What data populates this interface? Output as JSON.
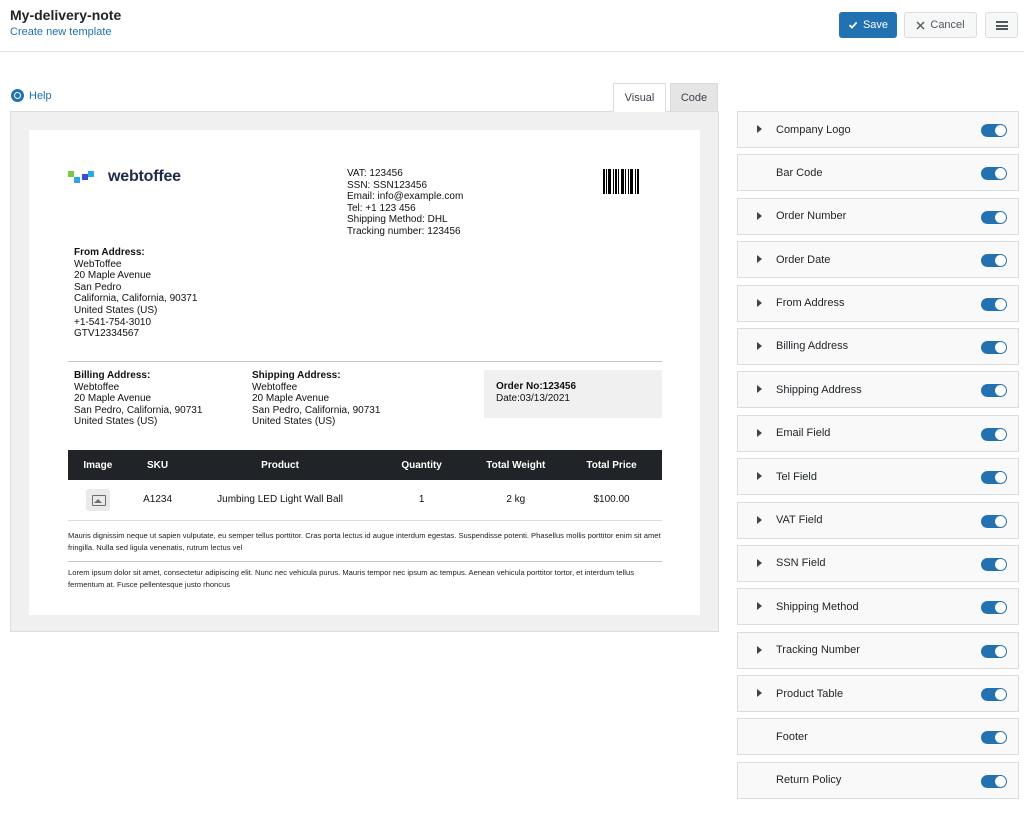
{
  "header": {
    "title": "My-delivery-note",
    "subtitle": "Create new template",
    "save_label": "Save",
    "cancel_label": "Cancel"
  },
  "help_label": "Help",
  "tabs": [
    {
      "label": "Visual",
      "active": true
    },
    {
      "label": "Code",
      "active": false
    }
  ],
  "document": {
    "logo_text": "webtoffee",
    "info": [
      "VAT: 123456",
      "SSN: SSN123456",
      "Email: info@example.com",
      "Tel: +1 123 456",
      "Shipping Method: DHL",
      "Tracking number: 123456"
    ],
    "from": {
      "heading": "From Address:",
      "lines": [
        "WebToffee",
        "20 Maple Avenue",
        "San Pedro",
        "California, California, 90371",
        "United States (US)",
        "+1-541-754-3010",
        "GTV12334567"
      ]
    },
    "billing": {
      "heading": "Billing Address:",
      "lines": [
        "Webtoffee",
        "20 Maple Avenue",
        "San Pedro, California, 90731",
        "United States (US)"
      ]
    },
    "shipping": {
      "heading": "Shipping Address:",
      "lines": [
        "Webtoffee",
        "20 Maple Avenue",
        "San Pedro, California, 90731",
        "United States (US)"
      ]
    },
    "order": {
      "number_label": "Order No:",
      "number": "123456",
      "date_line": "Date:03/13/2021"
    },
    "table": {
      "headers": [
        "Image",
        "SKU",
        "Product",
        "Quantity",
        "Total Weight",
        "Total Price"
      ],
      "rows": [
        {
          "sku": "A1234",
          "product": "Jumbing LED Light Wall Ball",
          "quantity": "1",
          "weight": "2 kg",
          "price": "$100.00"
        }
      ]
    },
    "footer_text": "Mauris dignissim neque ut sapien vulputate, eu semper tellus porttitor. Cras porta lectus id augue interdum egestas. Suspendisse potenti. Phasellus mollis porttitor enim sit amet fringilla. Nulla sed ligula venenatis, rutrum lectus vel",
    "return_policy_text": "Lorem ipsum dolor sit amet, consectetur adipiscing elit. Nunc nec vehicula purus. Mauris tempor nec ipsum ac tempus. Aenean vehicula porttitor tortor, et interdum tellus fermentum at. Fusce pellentesque justo rhoncus"
  },
  "panel": {
    "items": [
      {
        "label": "Company Logo",
        "expandable": true,
        "enabled": true
      },
      {
        "label": "Bar Code",
        "expandable": false,
        "enabled": true
      },
      {
        "label": "Order Number",
        "expandable": true,
        "enabled": true
      },
      {
        "label": "Order Date",
        "expandable": true,
        "enabled": true
      },
      {
        "label": "From Address",
        "expandable": true,
        "enabled": true
      },
      {
        "label": "Billing Address",
        "expandable": true,
        "enabled": true
      },
      {
        "label": "Shipping Address",
        "expandable": true,
        "enabled": true
      },
      {
        "label": "Email Field",
        "expandable": true,
        "enabled": true
      },
      {
        "label": "Tel Field",
        "expandable": true,
        "enabled": true
      },
      {
        "label": "VAT Field",
        "expandable": true,
        "enabled": true
      },
      {
        "label": "SSN Field",
        "expandable": true,
        "enabled": true
      },
      {
        "label": "Shipping Method",
        "expandable": true,
        "enabled": true
      },
      {
        "label": "Tracking Number",
        "expandable": true,
        "enabled": true
      },
      {
        "label": "Product Table",
        "expandable": true,
        "enabled": true
      },
      {
        "label": "Footer",
        "expandable": false,
        "enabled": true
      },
      {
        "label": "Return Policy",
        "expandable": false,
        "enabled": true
      }
    ]
  },
  "colors": {
    "primary": "#2271b1",
    "table_header": "#202327",
    "logo_green": "#7ac943",
    "logo_teal": "#29abe2",
    "logo_blue": "#3b4bd8"
  }
}
